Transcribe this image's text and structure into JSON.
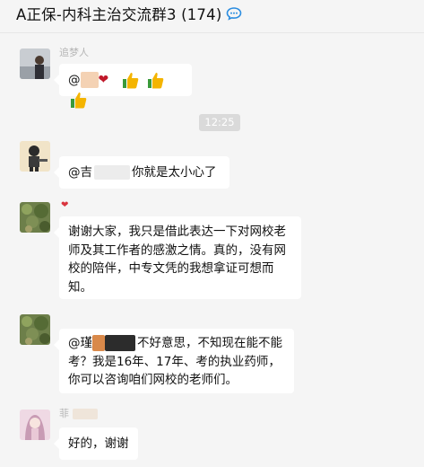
{
  "header": {
    "title": "A正保-内科主治交流群3 (174)"
  },
  "time_divider": "12:25",
  "messages": [
    {
      "sender": "追梦人",
      "text_prefix": "@",
      "text": ""
    },
    {
      "sender": "",
      "text_prefix": "@吉",
      "text": "你就是太小心了"
    },
    {
      "sender": "",
      "text": "谢谢大家，我只是借此表达一下对网校老师及其工作者的感激之情。真的，没有网校的陪伴，中专文凭的我想拿证可想而知。"
    },
    {
      "sender": "",
      "text_prefix": "@瑾",
      "text_line1": "不好意思，不知现在能不能",
      "text_line2": "考？我是16年、17年、考的执业药师，",
      "text_line3": "你可以咨询咱们网校的老师们。"
    },
    {
      "sender": "菲",
      "text": "好的，谢谢"
    }
  ],
  "bubble1_emoji": {
    "heart": "heart-icon",
    "thumbs": [
      "thumbs-up-icon",
      "thumbs-up-icon",
      "thumbs-up-icon"
    ]
  }
}
